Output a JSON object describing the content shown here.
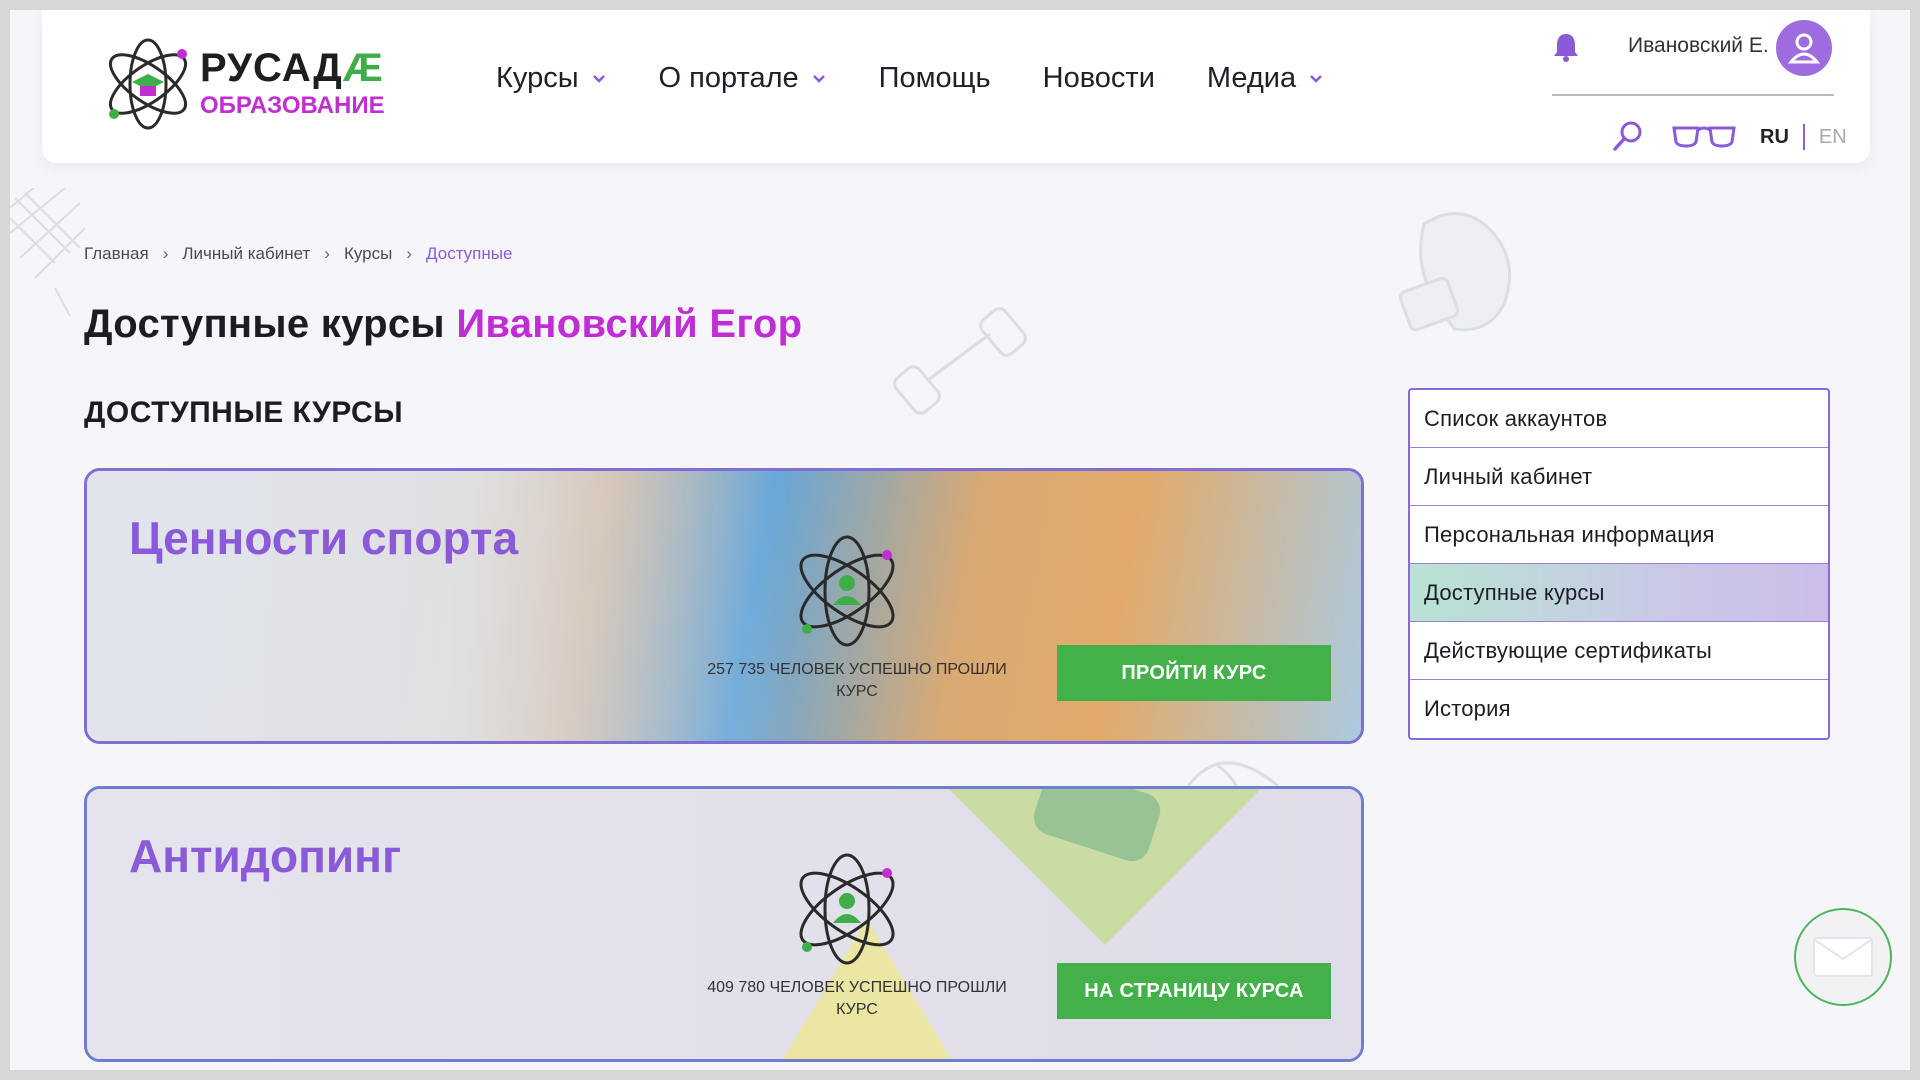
{
  "logo": {
    "title": "РУСАДА",
    "title_main": "РУСАД",
    "title_accent": "Æ",
    "subtitle": "ОБРАЗОВАНИЕ"
  },
  "nav": [
    {
      "label": "Курсы",
      "dropdown": true
    },
    {
      "label": "О портале",
      "dropdown": true
    },
    {
      "label": "Помощь",
      "dropdown": false
    },
    {
      "label": "Новости",
      "dropdown": false
    },
    {
      "label": "Медиа",
      "dropdown": true
    }
  ],
  "user": {
    "name": "Ивановский Е."
  },
  "lang": {
    "active": "RU",
    "other": "EN"
  },
  "breadcrumb": [
    "Главная",
    "Личный кабинет",
    "Курсы",
    "Доступные"
  ],
  "page": {
    "title": "Доступные курсы",
    "title_name": "Ивановский Егор",
    "section": "ДОСТУПНЫЕ КУРСЫ"
  },
  "courses": [
    {
      "title": "Ценности спорта",
      "count": "257 735 человек успешно прошли курс",
      "button": "ПРОЙТИ КУРС"
    },
    {
      "title": "Антидопинг",
      "count": "409 780 человек успешно прошли курс",
      "button": "НА СТРАНИЦУ КУРСА"
    }
  ],
  "side_menu": [
    {
      "label": "Список аккаунтов",
      "active": false
    },
    {
      "label": "Личный кабинет",
      "active": false
    },
    {
      "label": "Персональная информация",
      "active": false
    },
    {
      "label": "Доступные курсы",
      "active": true
    },
    {
      "label": "Действующие сертификаты",
      "active": false
    },
    {
      "label": "История",
      "active": false
    }
  ],
  "icons": [
    "bell-icon",
    "user-avatar-icon",
    "search-icon",
    "glasses-icon",
    "chevron-down-icon",
    "mail-icon",
    "atom-icon"
  ],
  "colors": {
    "accent_purple": "#8a5ad8",
    "accent_magenta": "#c02dd4",
    "button_green": "#43b049"
  }
}
